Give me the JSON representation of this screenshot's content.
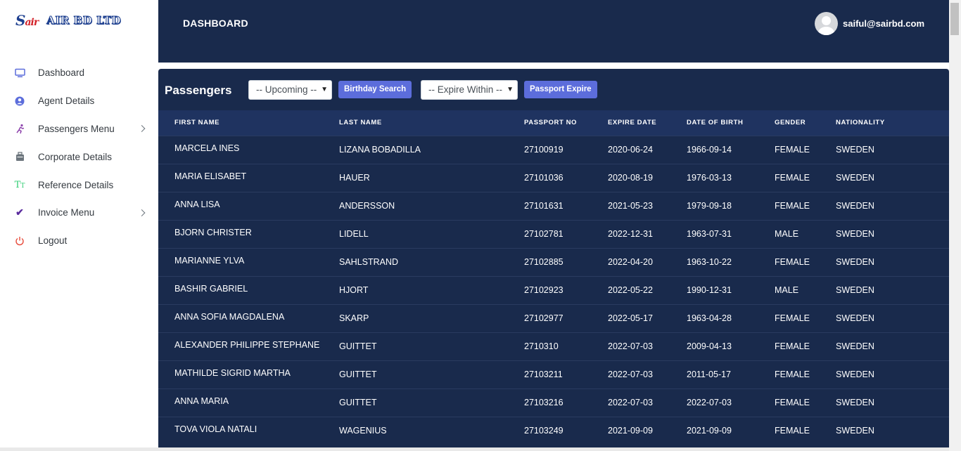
{
  "brand": {
    "mark": "S",
    "mark_red": "air",
    "text": "AIR BD LTD"
  },
  "sidebar": {
    "items": [
      {
        "label": "Dashboard",
        "icon": "monitor-icon",
        "color": "#5c6ddb",
        "submenu": false
      },
      {
        "label": "Agent Details",
        "icon": "user-circle-icon",
        "color": "#5c6ddb",
        "submenu": false
      },
      {
        "label": "Passengers Menu",
        "icon": "person-running-icon",
        "color": "#8e44ad",
        "submenu": true
      },
      {
        "label": "Corporate Details",
        "icon": "briefcase-icon",
        "color": "#6c757d",
        "submenu": false
      },
      {
        "label": "Reference Details",
        "icon": "text-height-icon",
        "color": "#2ecc71",
        "submenu": false
      },
      {
        "label": "Invoice Menu",
        "icon": "checkmark-icon",
        "color": "#5b2c9e",
        "submenu": true
      },
      {
        "label": "Logout",
        "icon": "power-icon",
        "color": "#e74c3c",
        "submenu": false
      }
    ]
  },
  "header": {
    "title": "DASHBOARD",
    "user_email": "saiful@sairbd.com"
  },
  "passengers": {
    "title": "Passengers",
    "upcoming_select": "-- Upcoming --",
    "birthday_button": "Birthday Search",
    "expire_select": "-- Expire Within --",
    "passport_button": "Passport Expire",
    "columns": [
      "FIRST NAME",
      "LAST NAME",
      "PASSPORT NO",
      "EXPIRE DATE",
      "DATE OF BIRTH",
      "GENDER",
      "NATIONALITY"
    ],
    "rows": [
      [
        "MARCELA INES",
        "LIZANA BOBADILLA",
        "27100919",
        "2020-06-24",
        "1966-09-14",
        "FEMALE",
        "SWEDEN"
      ],
      [
        "MARIA ELISABET",
        "HAUER",
        "27101036",
        "2020-08-19",
        "1976-03-13",
        "FEMALE",
        "SWEDEN"
      ],
      [
        "ANNA LISA",
        "ANDERSSON",
        "27101631",
        "2021-05-23",
        "1979-09-18",
        "FEMALE",
        "SWEDEN"
      ],
      [
        "BJORN CHRISTER",
        "LIDELL",
        "27102781",
        "2022-12-31",
        "1963-07-31",
        "MALE",
        "SWEDEN"
      ],
      [
        "MARIANNE YLVA",
        "SAHLSTRAND",
        "27102885",
        "2022-04-20",
        "1963-10-22",
        "FEMALE",
        "SWEDEN"
      ],
      [
        "BASHIR GABRIEL",
        "HJORT",
        "27102923",
        "2022-05-22",
        "1990-12-31",
        "MALE",
        "SWEDEN"
      ],
      [
        "ANNA SOFIA MAGDALENA",
        "SKARP",
        "27102977",
        "2022-05-17",
        "1963-04-28",
        "FEMALE",
        "SWEDEN"
      ],
      [
        "ALEXANDER PHILIPPE STEPHANE",
        "GUITTET",
        "2710310",
        "2022-07-03",
        "2009-04-13",
        "FEMALE",
        "SWEDEN"
      ],
      [
        "MATHILDE SIGRID MARTHA",
        "GUITTET",
        "27103211",
        "2022-07-03",
        "2011-05-17",
        "FEMALE",
        "SWEDEN"
      ],
      [
        "ANNA MARIA",
        "GUITTET",
        "27103216",
        "2022-07-03",
        "2022-07-03",
        "FEMALE",
        "SWEDEN"
      ],
      [
        "TOVA VIOLA NATALI",
        "WAGENIUS",
        "27103249",
        "2021-09-09",
        "2021-09-09",
        "FEMALE",
        "SWEDEN"
      ]
    ]
  }
}
